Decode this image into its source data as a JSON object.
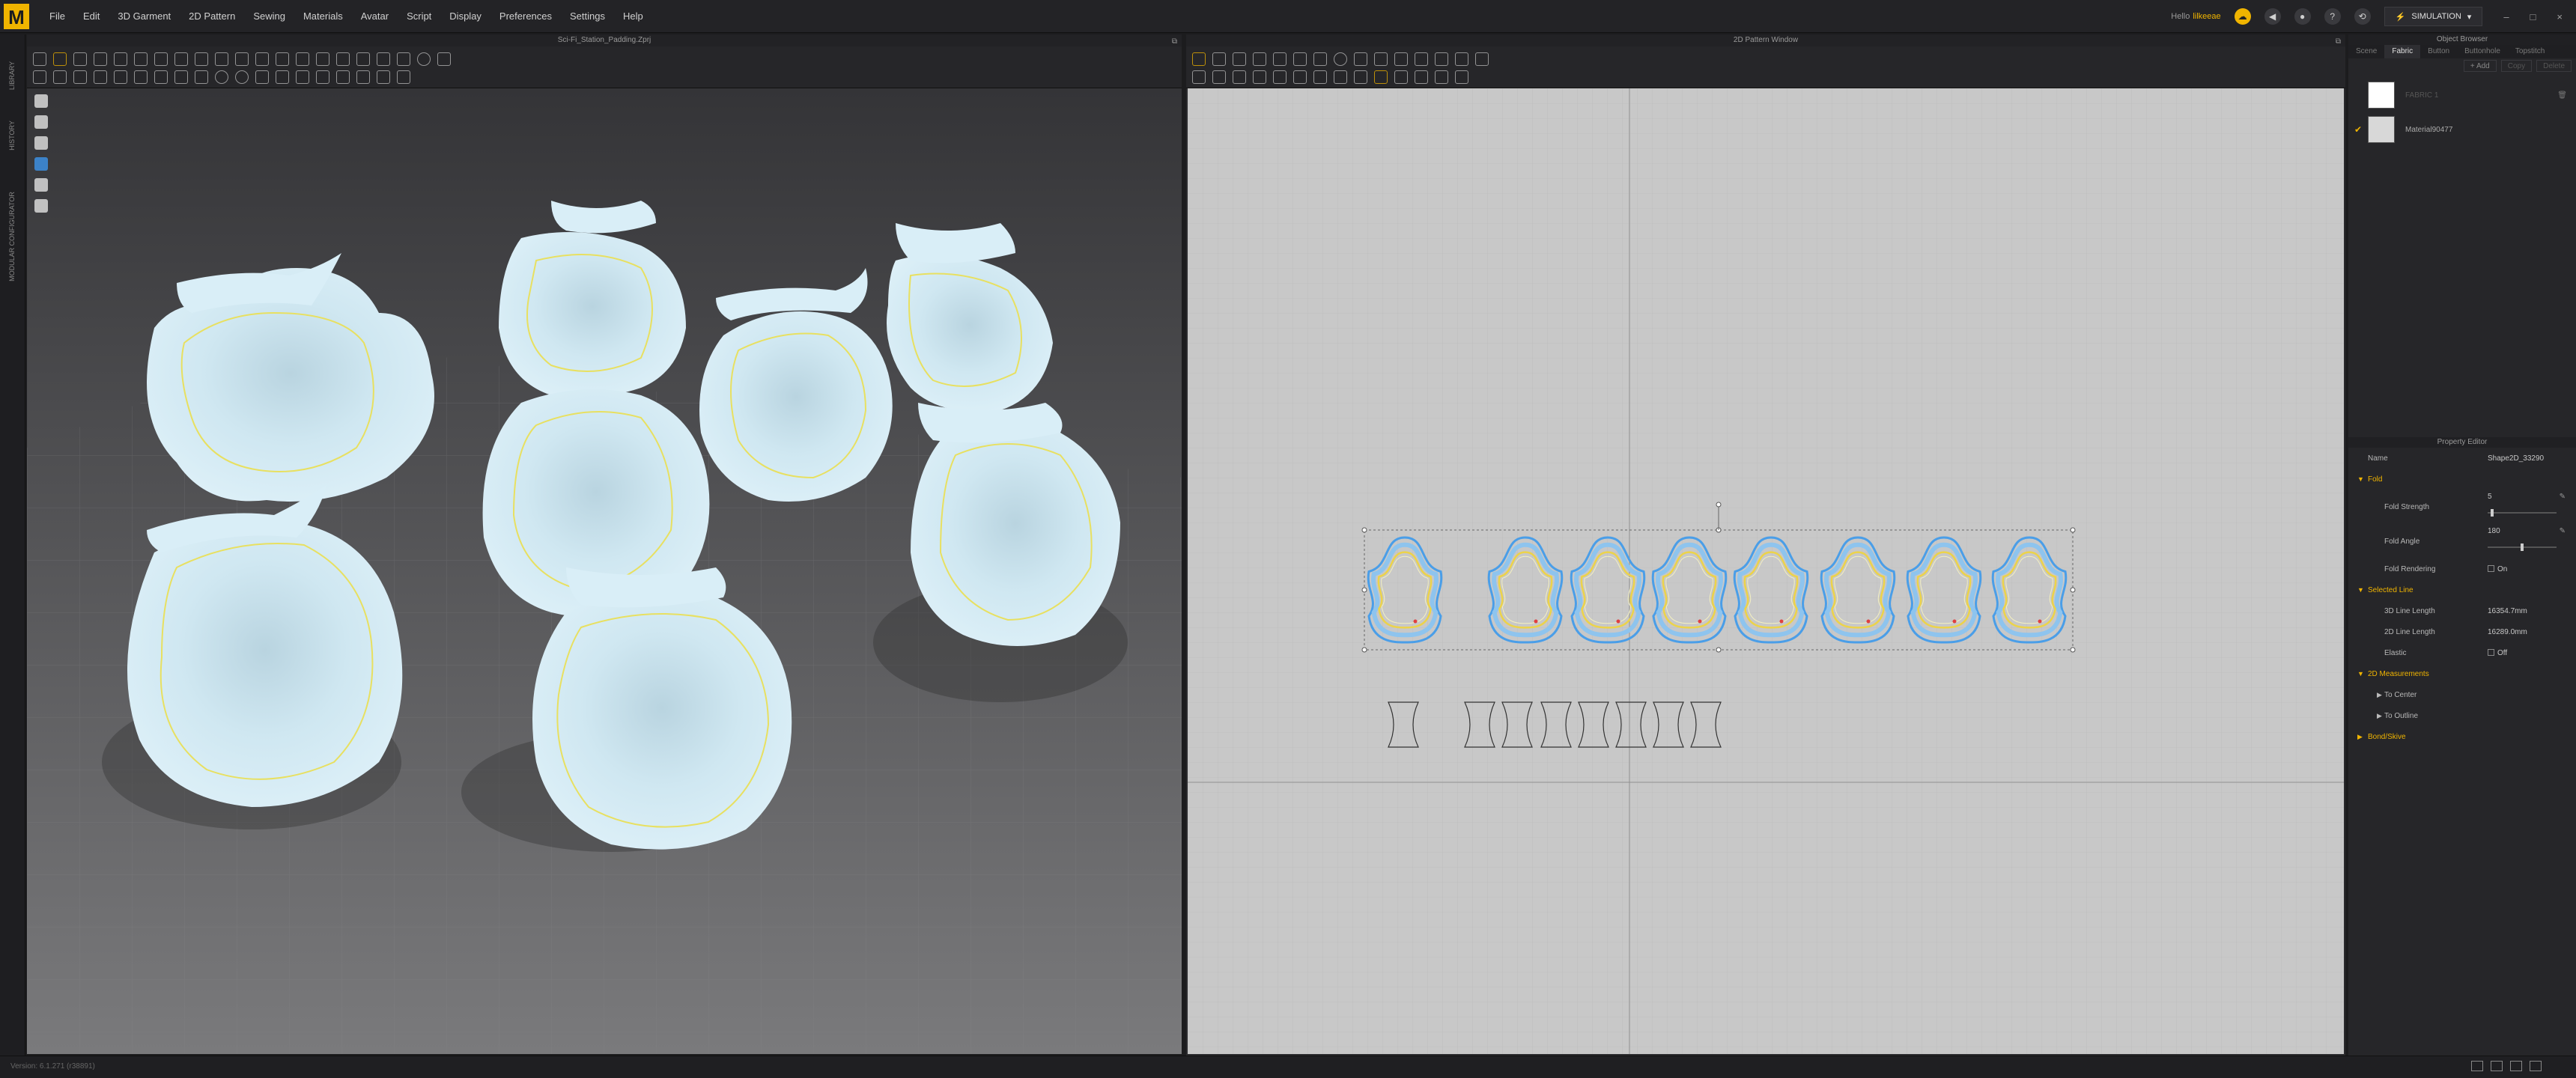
{
  "app": {
    "logo_letter": "M",
    "menu": [
      "File",
      "Edit",
      "3D Garment",
      "2D Pattern",
      "Sewing",
      "Materials",
      "Avatar",
      "Script",
      "Display",
      "Preferences",
      "Settings",
      "Help"
    ],
    "hello_label": "Hello",
    "username": "lilkeeae",
    "simulation_label": "SIMULATION",
    "window_controls": [
      "–",
      "□",
      "×"
    ],
    "accent": "#f0b400"
  },
  "left_strip": {
    "tabs": [
      "LIBRARY",
      "HISTORY",
      "MODULAR CONFIGURATOR"
    ]
  },
  "panel3d": {
    "title": "Sci-Fi_Station_Padding.Zprj"
  },
  "panel2d": {
    "title": "2D Pattern Window"
  },
  "object_browser": {
    "title": "Object Browser",
    "tabs": [
      "Scene",
      "Fabric",
      "Button",
      "Buttonhole",
      "Topstitch"
    ],
    "active_tab": "Fabric",
    "actions": {
      "add": "+ Add",
      "copy": "Copy",
      "delete": "Delete"
    },
    "items": [
      {
        "name": "FABRIC 1",
        "swatch": "#ffffff",
        "checked": false
      },
      {
        "name": "Material90477",
        "swatch": "#d8d8d8",
        "checked": true
      }
    ]
  },
  "property_editor": {
    "title": "Property Editor",
    "name_label": "Name",
    "name_value": "Shape2D_33290",
    "fold": {
      "section": "Fold",
      "strength_label": "Fold Strength",
      "strength_value": "5",
      "strength_frac": 0.05,
      "angle_label": "Fold Angle",
      "angle_value": "180",
      "angle_frac": 0.5,
      "rendering_label": "Fold Rendering",
      "rendering_value": "On"
    },
    "selected_line": {
      "section": "Selected Line",
      "l3d_label": "3D Line Length",
      "l3d_value": "16354.7mm",
      "l2d_label": "2D Line Length",
      "l2d_value": "16289.0mm",
      "elastic_label": "Elastic",
      "elastic_value": "Off"
    },
    "measurements": {
      "section": "2D Measurements",
      "to_center": "To Center",
      "to_outline": "To Outline"
    },
    "bond": "Bond/Skive"
  },
  "status": {
    "version": "Version: 6.1.271 (r38891)"
  }
}
